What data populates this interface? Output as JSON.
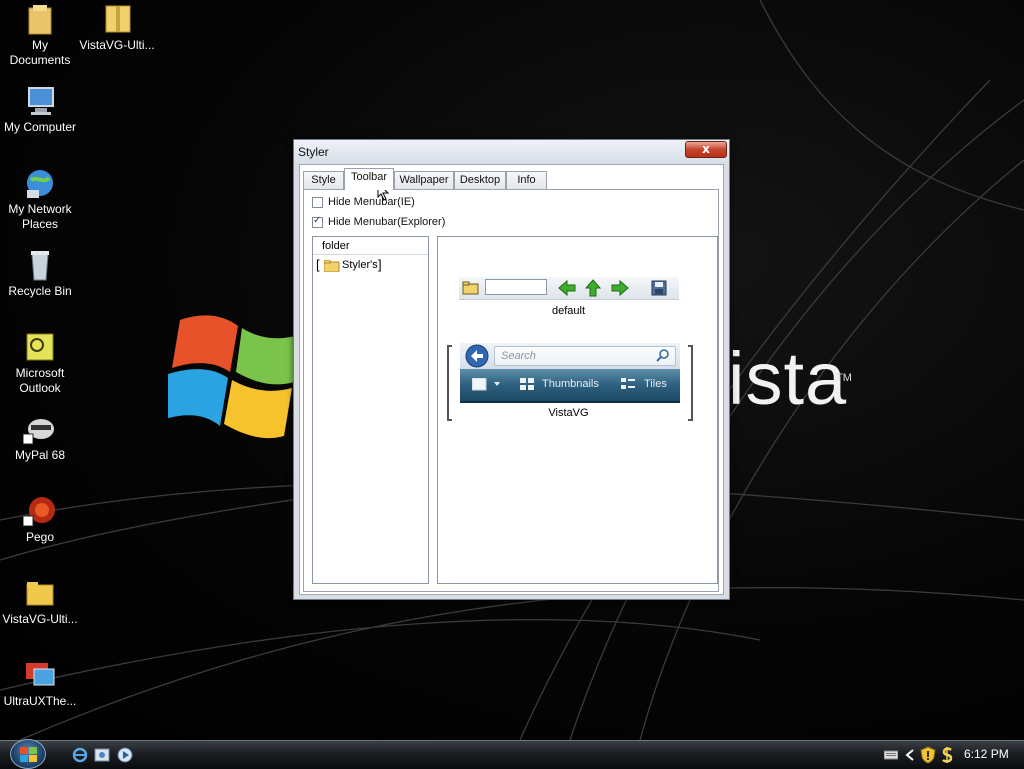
{
  "desktop": {
    "brand_text": "ista",
    "brand_tm": "TM",
    "icons": [
      {
        "label": "My\nDocuments"
      },
      {
        "label": "VistaVG-Ulti..."
      },
      {
        "label": "My Computer"
      },
      {
        "label": "My Network\nPlaces"
      },
      {
        "label": "Recycle Bin"
      },
      {
        "label": "Microsoft\nOutlook"
      },
      {
        "label": "MyPal 68"
      },
      {
        "label": "Pego"
      },
      {
        "label": "VistaVG-Ulti..."
      },
      {
        "label": "UltraUXThe..."
      }
    ]
  },
  "window": {
    "title": "Styler",
    "close_label": "x",
    "tabs": [
      {
        "label": "Style"
      },
      {
        "label": "Toolbar"
      },
      {
        "label": "Wallpaper"
      },
      {
        "label": "Desktop"
      },
      {
        "label": "Info"
      }
    ],
    "options": [
      {
        "label": "Hide Menubar(IE)",
        "checked": false
      },
      {
        "label": "Hide Menubar(Explorer)",
        "checked": true
      }
    ],
    "tree": {
      "header": "folder",
      "item": "Styler's"
    },
    "preview": {
      "default_label": "default",
      "vista_search_placeholder": "Search",
      "vista_thumbnails": "Thumbnails",
      "vista_tiles": "Tiles",
      "vista_label": "VistaVG"
    }
  },
  "taskbar": {
    "time": "6:12 PM"
  },
  "colors": {
    "accent_green": "#3fae2a",
    "close_red": "#c9452c",
    "vista_cmd_blue": "#2d607f"
  }
}
